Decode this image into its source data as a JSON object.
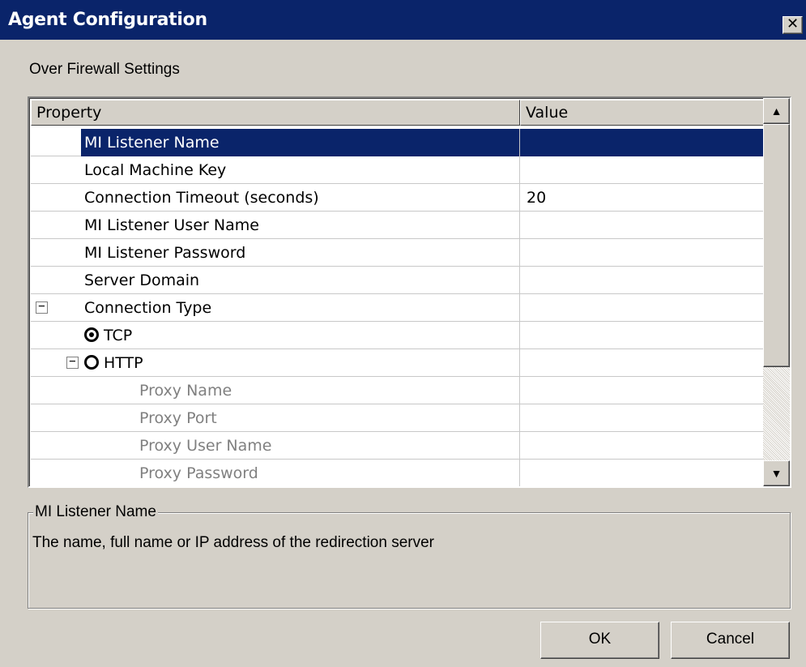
{
  "window": {
    "title": "Agent Configuration",
    "close_glyph": "✕"
  },
  "section_title": "Over Firewall Settings",
  "grid": {
    "columns": [
      "Property",
      "Value"
    ],
    "rows": [
      {
        "label": "MI Listener Name",
        "value": "",
        "level": 1,
        "selected": true
      },
      {
        "label": "Local Machine Key",
        "value": "",
        "level": 1
      },
      {
        "label": "Connection Timeout (seconds)",
        "value": "20",
        "level": 1
      },
      {
        "label": "MI Listener User Name",
        "value": "",
        "level": 1
      },
      {
        "label": "MI Listener Password",
        "value": "",
        "level": 1
      },
      {
        "label": "Server Domain",
        "value": "",
        "level": 1
      },
      {
        "label": "Connection Type",
        "value": "",
        "level": 1,
        "expander": "−"
      },
      {
        "label": "TCP",
        "value": "",
        "level": 2,
        "radio": "checked"
      },
      {
        "label": "HTTP",
        "value": "",
        "level": 2,
        "radio": "unchecked",
        "expander": "−"
      },
      {
        "label": "Proxy Name",
        "value": "",
        "level": 3,
        "disabled": true
      },
      {
        "label": "Proxy Port",
        "value": "",
        "level": 3,
        "disabled": true
      },
      {
        "label": "Proxy User Name",
        "value": "",
        "level": 3,
        "disabled": true
      },
      {
        "label": "Proxy Password",
        "value": "",
        "level": 3,
        "disabled": true
      }
    ],
    "scroll_up_glyph": "▲",
    "scroll_down_glyph": "▼"
  },
  "description": {
    "title": "MI Listener Name",
    "text": "The name, full name or IP address of the redirection server"
  },
  "buttons": {
    "ok": "OK",
    "cancel": "Cancel"
  },
  "colors": {
    "titlebar": "#0a246a",
    "selection": "#0a246a",
    "face": "#d4d0c8",
    "disabled_text": "#808080"
  }
}
